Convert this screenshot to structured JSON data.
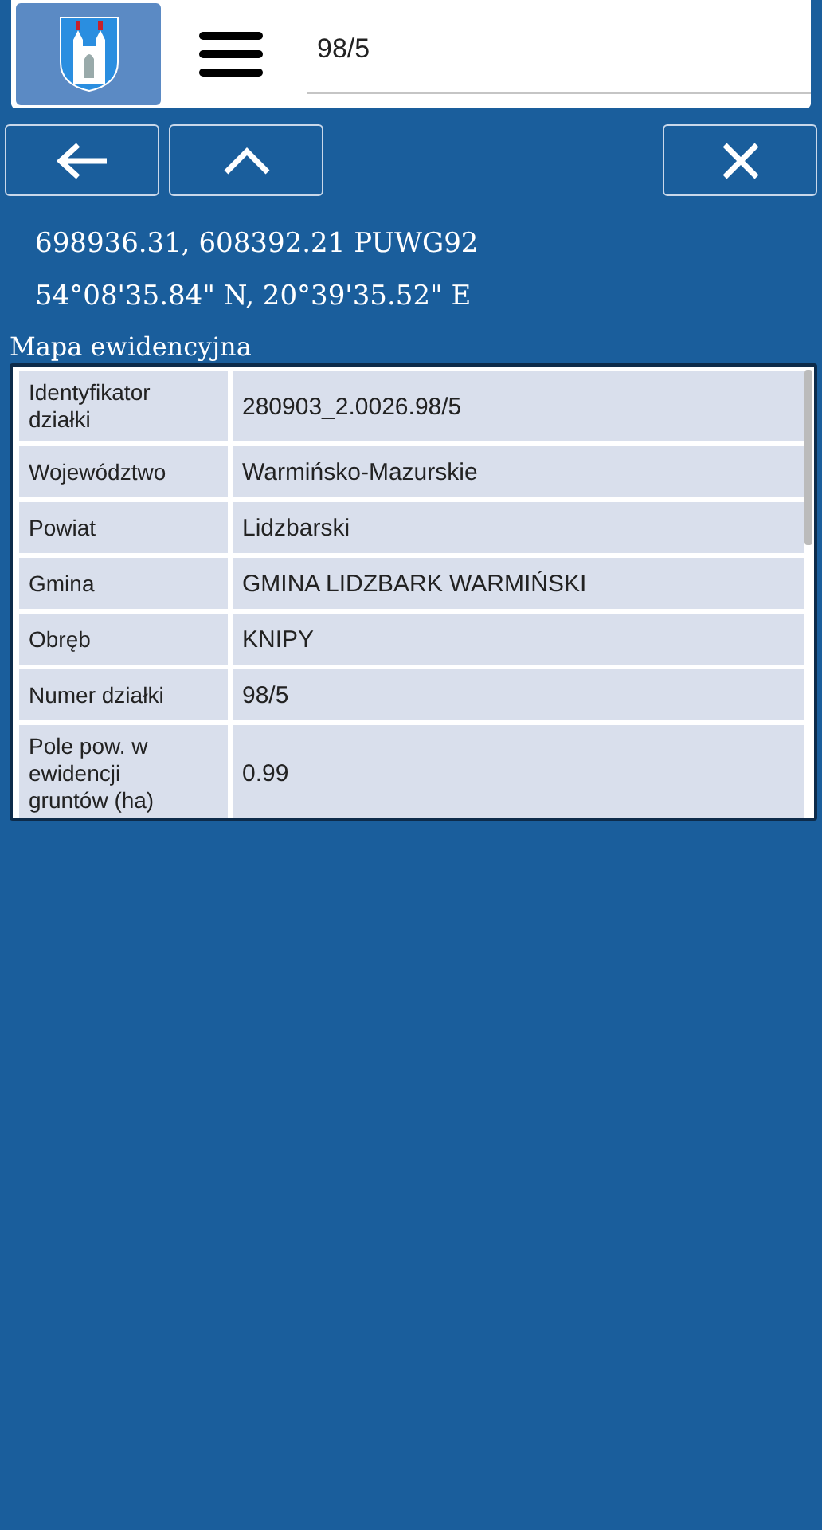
{
  "search": {
    "value": "98/5"
  },
  "coordinates": [
    "698936.31, 608392.21 PUWG92",
    "54°08'35.84\" N, 20°39'35.52\" E"
  ],
  "section_title": "Mapa ewidencyjna",
  "table": {
    "rows": [
      {
        "label": "Identyfikator działki",
        "value": "280903_2.0026.98/5"
      },
      {
        "label": "Województwo",
        "value": "Warmińsko-Mazurskie"
      },
      {
        "label": "Powiat",
        "value": "Lidzbarski"
      },
      {
        "label": "Gmina",
        "value": "GMINA LIDZBARK WARMIŃSKI"
      },
      {
        "label": "Obręb",
        "value": "KNIPY"
      },
      {
        "label": "Numer działki",
        "value": "98/5"
      },
      {
        "label": "Pole pow. w ewidencji gruntów (ha)",
        "value": "0.99"
      }
    ]
  }
}
